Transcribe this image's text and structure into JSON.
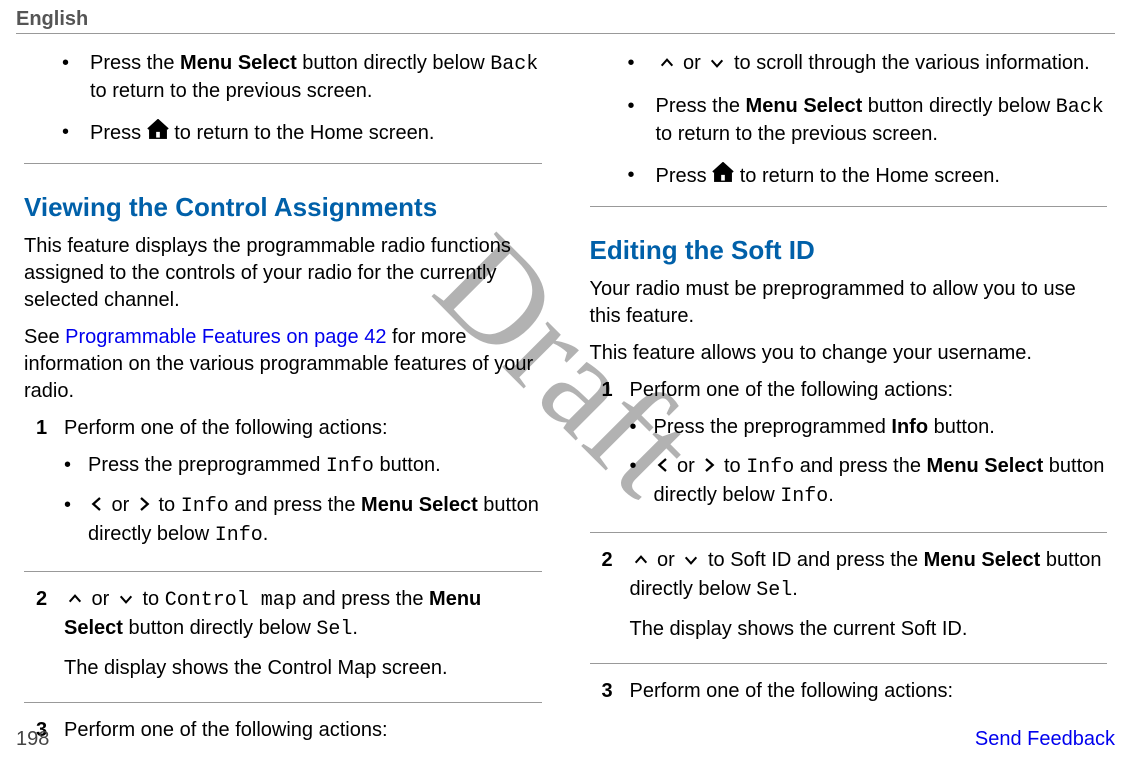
{
  "header": {
    "language": "English"
  },
  "watermark": "Draft",
  "footer": {
    "page": "198",
    "feedback": "Send Feedback"
  },
  "left": {
    "intro_bullets": {
      "b1_pre": "Press the ",
      "b1_bold": "Menu Select",
      "b1_mid": " button directly below ",
      "b1_code": "Back",
      "b1_post": " to return to the previous screen.",
      "b2_pre": "Press ",
      "b2_post": " to return to the Home screen."
    },
    "h2": "Viewing the Control Assignments",
    "p1": "This feature displays the programmable radio functions assigned to the controls of your radio for the currently selected channel.",
    "p2_pre": "See ",
    "p2_link": "Programmable Features on page 42",
    "p2_post": " for more information on the various programmable features of your radio.",
    "s1": {
      "num": "1",
      "lead": "Perform one of the following actions:",
      "a_pre": "Press the preprogrammed ",
      "a_code": "Info",
      "a_post": " button.",
      "b_mid1": " or ",
      "b_mid2": " to ",
      "b_code1": "Info",
      "b_mid3": " and press the ",
      "b_bold": "Menu Select",
      "b_mid4": " button directly below ",
      "b_code2": "Info",
      "b_post": "."
    },
    "s2": {
      "num": "2",
      "mid1": " or ",
      "mid2": " to ",
      "code": "Control map",
      "mid3": " and press the ",
      "bold": "Menu Select",
      "mid4": " button directly below ",
      "code2": "Sel",
      "post": ".",
      "result": "The display shows the Control Map screen."
    },
    "s3": {
      "num": "3",
      "lead": "Perform one of the following actions:"
    }
  },
  "right": {
    "intro_bullets": {
      "b1_mid1": " or ",
      "b1_post": " to scroll through the various information.",
      "b2_pre": "Press the ",
      "b2_bold": "Menu Select",
      "b2_mid": " button directly below ",
      "b2_code": "Back",
      "b2_post": " to return to the previous screen.",
      "b3_pre": "Press ",
      "b3_post": " to return to the Home screen."
    },
    "h2": "Editing the Soft ID",
    "p1": "Your radio must be preprogrammed to allow you to use this feature.",
    "p2": "This feature allows you to change your username.",
    "s1": {
      "num": "1",
      "lead": "Perform one of the following actions:",
      "a_pre": "Press the preprogrammed ",
      "a_bold": "Info",
      "a_post": " button.",
      "b_mid1": " or ",
      "b_mid2": " to ",
      "b_code1": "Info",
      "b_mid3": " and press the ",
      "b_bold": "Menu Select",
      "b_mid4": " button directly below ",
      "b_code2": "Info",
      "b_post": "."
    },
    "s2": {
      "num": "2",
      "mid1": " or ",
      "mid2": " to Soft ID and press the ",
      "bold": "Menu Select",
      "mid3": " button directly below ",
      "code": "Sel",
      "post": ".",
      "result": "The display shows the current Soft ID."
    },
    "s3": {
      "num": "3",
      "lead": "Perform one of the following actions:"
    }
  }
}
